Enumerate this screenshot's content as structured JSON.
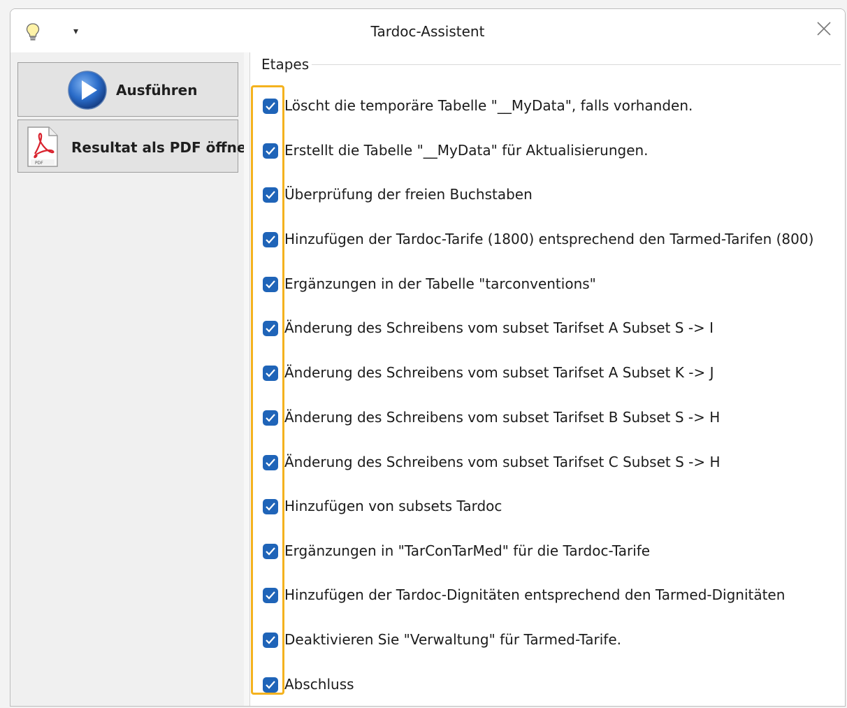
{
  "window": {
    "title": "Tardoc-Assistent",
    "quick_access_glyph": "▾",
    "icons": {
      "app": "lightbulb-icon",
      "close": "close-icon"
    }
  },
  "left_pane": {
    "run_button": {
      "label": "Ausführen",
      "icon": "play-icon"
    },
    "pdf_button": {
      "label": "Resultat als PDF öffnen",
      "icon": "pdf-icon"
    }
  },
  "steps_group": {
    "title": "Etapes",
    "steps": [
      {
        "label": "Löscht die temporäre Tabelle \"__MyData\", falls vorhanden.",
        "checked": true
      },
      {
        "label": "Erstellt die Tabelle \"__MyData\" für Aktualisierungen.",
        "checked": true
      },
      {
        "label": "Überprüfung der freien Buchstaben",
        "checked": true
      },
      {
        "label": "Hinzufügen der Tardoc-Tarife (1800) entsprechend den Tarmed-Tarifen (800)",
        "checked": true
      },
      {
        "label": "Ergänzungen in der Tabelle \"tarconventions\"",
        "checked": true
      },
      {
        "label": "Änderung des Schreibens vom subset  Tarifset A Subset S -> I",
        "checked": true
      },
      {
        "label": "Änderung des Schreibens vom subset  Tarifset A Subset K -> J",
        "checked": true
      },
      {
        "label": "Änderung des Schreibens vom subset  Tarifset B Subset S -> H",
        "checked": true
      },
      {
        "label": "Änderung des Schreibens vom subset  Tarifset C Subset S -> H",
        "checked": true
      },
      {
        "label": "Hinzufügen von subsets Tardoc",
        "checked": true
      },
      {
        "label": "Ergänzungen in \"TarConTarMed\" für die Tardoc-Tarife",
        "checked": true
      },
      {
        "label": "Hinzufügen der Tardoc-Dignitäten entsprechend den Tarmed-Dignitäten",
        "checked": true
      },
      {
        "label": "Deaktivieren Sie \"Verwaltung\" für Tarmed-Tarife.",
        "checked": true
      },
      {
        "label": "Abschluss",
        "checked": true
      }
    ]
  },
  "colors": {
    "checkbox": "#1f64b8",
    "highlight": "#f4b21e",
    "button_bg": "#e3e3e3"
  }
}
